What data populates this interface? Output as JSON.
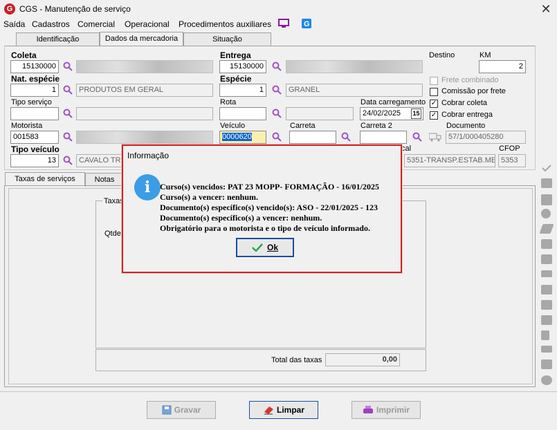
{
  "window": {
    "title": "CGS - Manutenção de serviço",
    "close": "✕"
  },
  "menu": [
    "Saída",
    "Cadastros",
    "Comercial",
    "Operacional",
    "Procedimentos auxiliares"
  ],
  "tabs": [
    "Identificação",
    "Dados da mercadoria",
    "Situação"
  ],
  "form": {
    "coleta_label": "Coleta",
    "coleta_value": "15130000",
    "entrega_label": "Entrega",
    "entrega_value": "15130000",
    "destino_label": "Destino",
    "km_label": "KM",
    "km_value": "2",
    "nat_especie_label": "Nat. espécie",
    "nat_especie_value": "1",
    "nat_especie_desc": "PRODUTOS EM GERAL",
    "especie_label": "Espécie",
    "especie_value": "1",
    "especie_desc": "GRANEL",
    "frete_combinado": "Frete combinado",
    "comissao_frete": "Comissão por frete",
    "cobrar_coleta": "Cobrar coleta",
    "cobrar_entrega": "Cobrar entrega",
    "tipo_servico_label": "Tipo serviço",
    "rota_label": "Rota",
    "data_carregamento_label": "Data carregamento",
    "data_carregamento_value": "24/02/2025",
    "calendar_day": "15",
    "motorista_label": "Motorista",
    "motorista_value": "001583",
    "veiculo_label": "Veículo",
    "veiculo_value": "0000620",
    "carreta_label": "Carreta",
    "carreta2_label": "Carreta 2",
    "documento_label": "Documento",
    "documento_value": "57/1/000405280",
    "tipo_veiculo_label": "Tipo veículo",
    "tipo_veiculo_value": "13",
    "tipo_veiculo_desc": "CAVALO TRU",
    "natureza_fiscal_partial": "cal",
    "natureza_fiscal_value": "5351-TRANSP.ESTAB.ME",
    "cfop_label": "CFOP",
    "cfop_value": "5353"
  },
  "bottom_tabs": [
    "Taxas de serviços",
    "Notas"
  ],
  "taxas": {
    "group_label": "Taxas",
    "qtde_label": "Qtde",
    "total_label": "Total das taxas",
    "total_value": "0,00"
  },
  "buttons": {
    "gravar": "Gravar",
    "limpar": "Limpar",
    "imprimir": "Imprimir"
  },
  "dialog": {
    "title": "Informação",
    "lines": [
      "Curso(s) vencidos: PAT 23 MOPP- FORMAÇÃO - 16/01/2025",
      "Curso(s) a vencer:  nenhum.",
      "Documento(s) específico(s) vencido(s): ASO  - 22/01/2025 - 123",
      "Documento(s) específico(s) a vencer:  nenhum.",
      "Obrigatório para o motorista e o tipo de veículo informado."
    ],
    "ok_label": "Ok",
    "icon_glyph": "i"
  },
  "colors": {
    "dialog_border": "#d02020",
    "info_icon": "#3c9ce6",
    "accent": "#c8202a"
  }
}
